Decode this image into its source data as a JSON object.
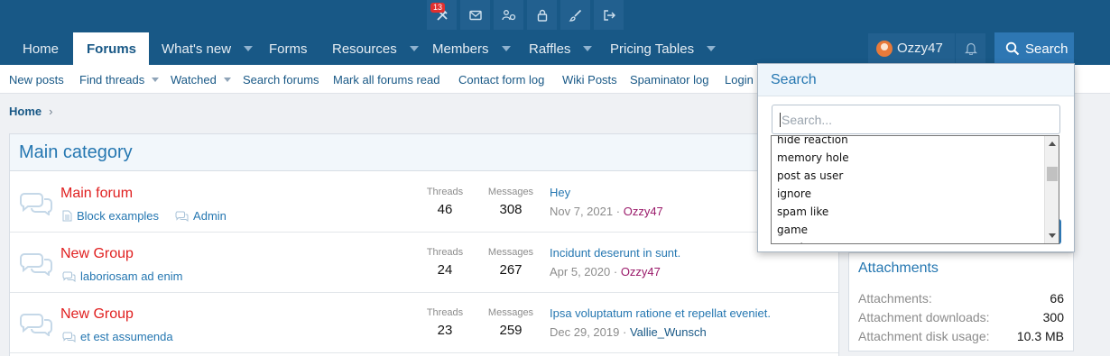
{
  "topbar": {
    "icons": [
      "tools-icon",
      "envelope-icon",
      "users-cog-icon",
      "lock-icon",
      "brush-icon",
      "logout-icon"
    ],
    "alert_count": "13"
  },
  "nav": {
    "tabs": [
      {
        "label": "Home"
      },
      {
        "label": "Forums"
      },
      {
        "label": "What's new"
      },
      {
        "label": "Forms"
      },
      {
        "label": "Resources"
      },
      {
        "label": "Members"
      },
      {
        "label": "Raffles"
      },
      {
        "label": "Pricing Tables"
      }
    ],
    "username": "Ozzy47",
    "search_label": "Search"
  },
  "subnav": {
    "items": [
      {
        "label": "New posts"
      },
      {
        "label": "Find threads"
      },
      {
        "label": "Watched"
      },
      {
        "label": "Search forums"
      },
      {
        "label": "Mark all forums read"
      },
      {
        "label": "Contact form log"
      },
      {
        "label": "Wiki Posts"
      },
      {
        "label": "Spaminator log"
      },
      {
        "label": "Login"
      }
    ]
  },
  "breadcrumb": {
    "home": "Home",
    "chevron": "›"
  },
  "main": {
    "category_title": "Main category",
    "stat_labels": {
      "threads": "Threads",
      "messages": "Messages"
    },
    "nodes": [
      {
        "title": "Main forum",
        "subforums": [
          "Block examples",
          "Admin"
        ],
        "threads": "46",
        "messages": "308",
        "latest_title": "Hey",
        "latest_date": "Nov 7, 2021",
        "latest_user": "Ozzy47"
      },
      {
        "title": "New Group",
        "subforums": [
          "laboriosam ad enim"
        ],
        "threads": "24",
        "messages": "267",
        "latest_title": "Incidunt deserunt in sunt.",
        "latest_date": "Apr 5, 2020",
        "latest_user": "Ozzy47"
      },
      {
        "title": "New Group",
        "subforums": [
          "et est assumenda"
        ],
        "threads": "23",
        "messages": "259",
        "latest_title": "Ipsa voluptatum ratione et repellat eveniet.",
        "latest_date": "Dec 29, 2019",
        "latest_user": "Vallie_Wunsch"
      }
    ],
    "separator": "·"
  },
  "sidebar": {
    "attachments_title": "Attachments",
    "rows": [
      {
        "label": "Attachments:",
        "value": "66"
      },
      {
        "label": "Attachment downloads:",
        "value": "300"
      },
      {
        "label": "Attachment disk usage:",
        "value": "10.3 MB"
      }
    ]
  },
  "search_dropdown": {
    "title": "Search",
    "placeholder": "Search...",
    "options": [
      "hide reaction",
      "memory hole",
      "post as user",
      "ignore",
      "spam like",
      "game",
      "music"
    ]
  },
  "colors": {
    "header_bg": "#185886",
    "accent": "#2577b1",
    "forum_title": "#e02020",
    "search_button": "#2e77b3"
  }
}
